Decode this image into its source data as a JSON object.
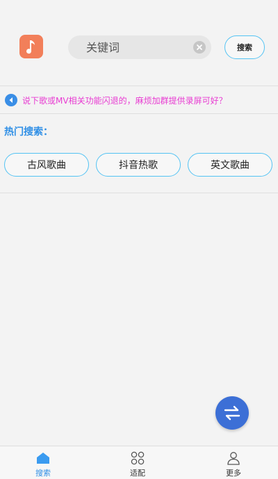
{
  "header": {
    "logo_icon": "music-note-icon",
    "search_placeholder": "关键词",
    "search_value": "",
    "clear_icon": "clear-x-icon",
    "search_button_label": "搜索"
  },
  "notice": {
    "icon": "speaker-icon",
    "text": "说下歌或MV相关功能闪退的，麻烦加群提供录屏可好？"
  },
  "hot_search": {
    "title": "热门搜索：",
    "tags": [
      "古风歌曲",
      "抖音热歌",
      "英文歌曲"
    ]
  },
  "fab": {
    "icon": "swap-arrows-icon"
  },
  "bottom_nav": {
    "items": [
      {
        "label": "搜索",
        "icon": "home-icon",
        "active": true
      },
      {
        "label": "适配",
        "icon": "grid-icon",
        "active": false
      },
      {
        "label": "更多",
        "icon": "user-icon",
        "active": false
      }
    ]
  },
  "colors": {
    "accent": "#53c3f3",
    "notice_text": "#e83bd2",
    "hot_title": "#2f8fe6",
    "logo": "#f27f5a",
    "fab": "#3c6fd6"
  }
}
